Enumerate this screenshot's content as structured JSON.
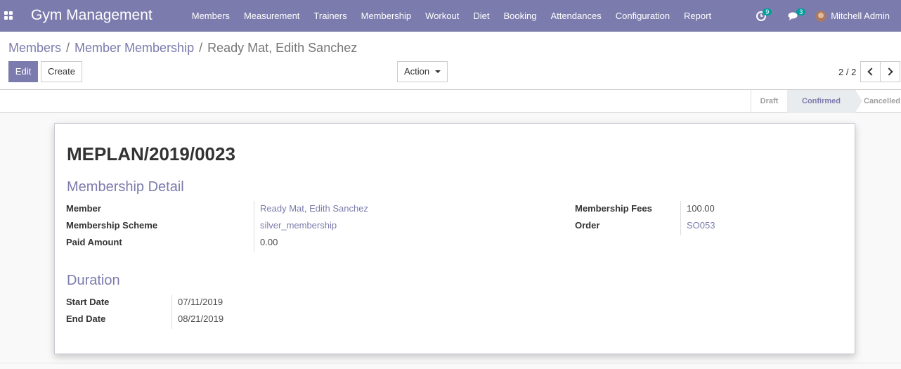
{
  "navbar": {
    "brand": "Gym Management",
    "menu": [
      "Members",
      "Measurement",
      "Trainers",
      "Membership",
      "Workout",
      "Diet",
      "Booking",
      "Attendances",
      "Configuration",
      "Report"
    ],
    "activities_count": "9",
    "messages_count": "3",
    "user_name": "Mitchell Admin",
    "accent_color": "#7c7bad",
    "badge_color": "#00a09d"
  },
  "breadcrumb": {
    "items": [
      "Members",
      "Member Membership"
    ],
    "current": "Ready Mat, Edith Sanchez"
  },
  "buttons": {
    "edit": "Edit",
    "create": "Create",
    "action": "Action"
  },
  "pager": {
    "value": "2 / 2"
  },
  "status": {
    "stages": [
      "Draft",
      "Confirmed",
      "Cancelled"
    ],
    "current": "Confirmed"
  },
  "record": {
    "title": "MEPLAN/2019/0023",
    "membership_detail": {
      "heading": "Membership Detail",
      "member_label": "Member",
      "member": "Ready Mat, Edith Sanchez",
      "scheme_label": "Membership Scheme",
      "scheme": "silver_membership",
      "paid_label": "Paid Amount",
      "paid": "0.00",
      "fees_label": "Membership Fees",
      "fees": "100.00",
      "order_label": "Order",
      "order": "SO053"
    },
    "duration": {
      "heading": "Duration",
      "start_label": "Start Date",
      "start": "07/11/2019",
      "end_label": "End Date",
      "end": "08/21/2019"
    }
  }
}
